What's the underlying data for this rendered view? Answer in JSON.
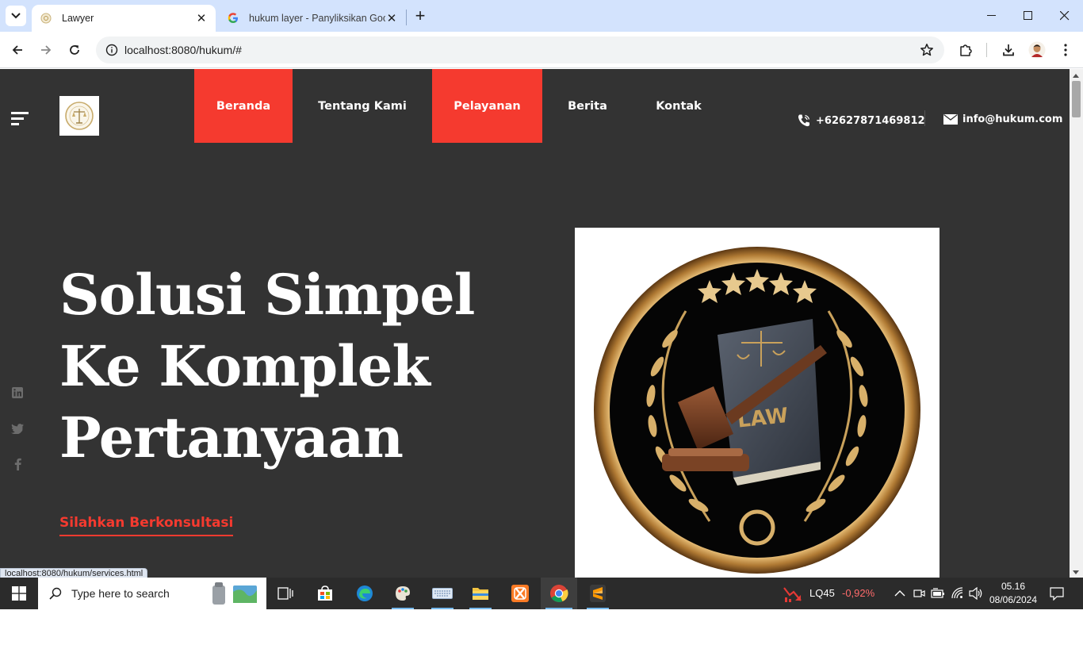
{
  "browser": {
    "tabs": [
      {
        "title": "Lawyer",
        "active": true
      },
      {
        "title": "hukum layer - Panyliksikan Goo",
        "active": false
      }
    ],
    "url": "localhost:8080/hukum/#",
    "status_url": "localhost:8080/hukum/services.html"
  },
  "site": {
    "nav": [
      {
        "label": "Beranda",
        "highlight": true
      },
      {
        "label": "Tentang Kami",
        "highlight": false
      },
      {
        "label": "Pelayanan",
        "highlight": true
      },
      {
        "label": "Berita",
        "highlight": false
      },
      {
        "label": "Kontak",
        "highlight": false
      }
    ],
    "phone": "+6262787146981 2",
    "email": "info@hukum.com",
    "hero_lines": [
      "Solusi Simpel",
      "Ke Komplek",
      "Pertanyaan"
    ],
    "cta": "Silahkan Berkonsultasi",
    "image_label": "LAW",
    "social": [
      "linkedin-icon",
      "twitter-icon",
      "facebook-icon"
    ],
    "colors": {
      "accent": "#f53a2f",
      "background": "#333333"
    }
  },
  "taskbar": {
    "search_placeholder": "Type here to search",
    "ticker": "LQ45",
    "ticker_change": "-0,92%",
    "time": "05.16",
    "date": "08/06/2024"
  }
}
